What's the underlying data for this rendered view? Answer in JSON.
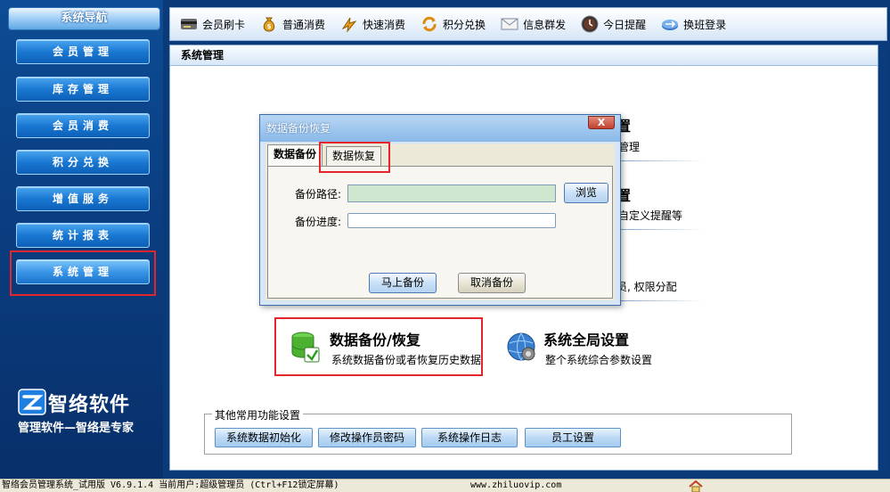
{
  "sidebar": {
    "title": "系统导航",
    "items": [
      {
        "label": "会员管理"
      },
      {
        "label": "库存管理"
      },
      {
        "label": "会员消费"
      },
      {
        "label": "积分兑换"
      },
      {
        "label": "增值服务"
      },
      {
        "label": "统计报表"
      },
      {
        "label": "系统管理"
      }
    ],
    "active_item": "系统管理",
    "brand": {
      "name": "智络软件",
      "slogan": "管理软件—智络是专家"
    }
  },
  "toolbar": {
    "items": [
      {
        "label": "会员刷卡",
        "icon": "card-reader-icon"
      },
      {
        "label": "普通消费",
        "icon": "money-bag-icon"
      },
      {
        "label": "快速消费",
        "icon": "fast-pay-icon"
      },
      {
        "label": "积分兑换",
        "icon": "exchange-icon"
      },
      {
        "label": "信息群发",
        "icon": "envelope-icon"
      },
      {
        "label": "今日提醒",
        "icon": "clock-icon"
      },
      {
        "label": "换班登录",
        "icon": "shift-login-icon"
      }
    ]
  },
  "main": {
    "header": "系统管理",
    "features": [
      {
        "title_partial": "置",
        "desc_partial": "管理"
      },
      {
        "title_partial": "置",
        "desc_partial": "自定义提醒等"
      },
      {
        "desc_partial": "员, 权限分配"
      },
      {
        "title": "数据备份/恢复",
        "desc": "系统数据备份或者恢复历史数据",
        "icon": "backup-database-icon"
      },
      {
        "title": "系统全局设置",
        "desc": "整个系统综合参数设置",
        "icon": "global-settings-icon"
      }
    ],
    "common_functions": {
      "legend": "其他常用功能设置",
      "buttons": [
        "系统数据初始化",
        "修改操作员密码",
        "系统操作日志",
        "员工设置"
      ]
    }
  },
  "dialog": {
    "title": "数据备份恢复",
    "close_label": "X",
    "tabs": [
      "数据备份",
      "数据恢复"
    ],
    "active_tab": "数据备份",
    "backup_path_label": "备份路径:",
    "backup_path_value": "",
    "browse_label": "浏览",
    "progress_label": "备份进度:",
    "progress": 0,
    "backup_now_label": "马上备份",
    "cancel_label": "取消备份"
  },
  "statusbar": {
    "app_info": "智络会员管理系统_试用版 V6.9.1.4 当前用户:超级管理员 (Ctrl+F12锁定屏幕)",
    "website": "www.zhiluovip.com",
    "home_icon": "home-icon"
  },
  "colors": {
    "sidebar_bg": "#0b3a78",
    "highlight_red": "#e3262b",
    "path_input_bg": "#cde6cd"
  }
}
